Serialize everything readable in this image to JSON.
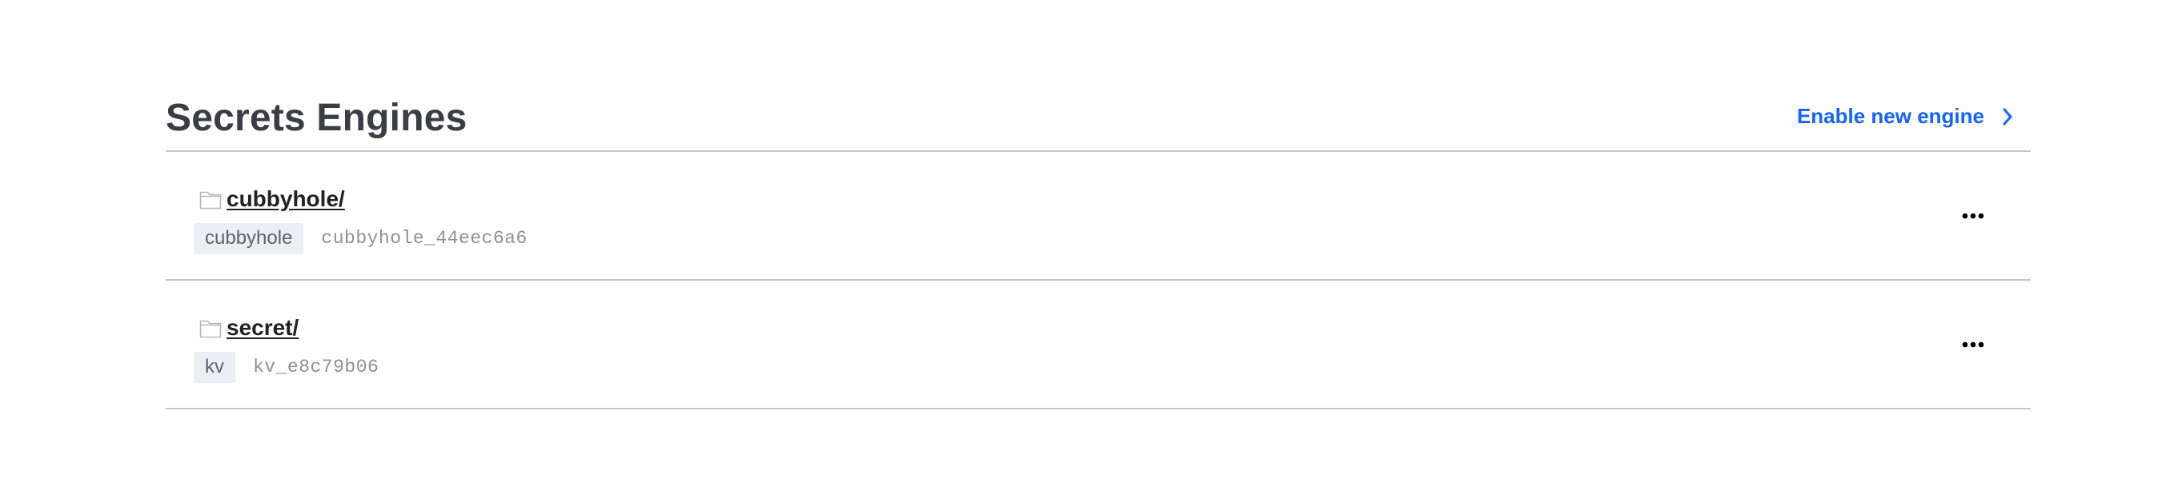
{
  "header": {
    "title": "Secrets Engines",
    "enable_link_label": "Enable new engine",
    "enable_link_icon": "chevron-right-icon",
    "accent_color": "#1563ff"
  },
  "engines": [
    {
      "path": "cubbyhole/",
      "type": "cubbyhole",
      "accessor": "cubbyhole_44eec6a6",
      "icon": "folder-icon",
      "menu_icon": "more-horizontal-icon"
    },
    {
      "path": "secret/",
      "type": "kv",
      "accessor": "kv_e8c79b06",
      "icon": "folder-icon",
      "menu_icon": "more-horizontal-icon"
    }
  ]
}
